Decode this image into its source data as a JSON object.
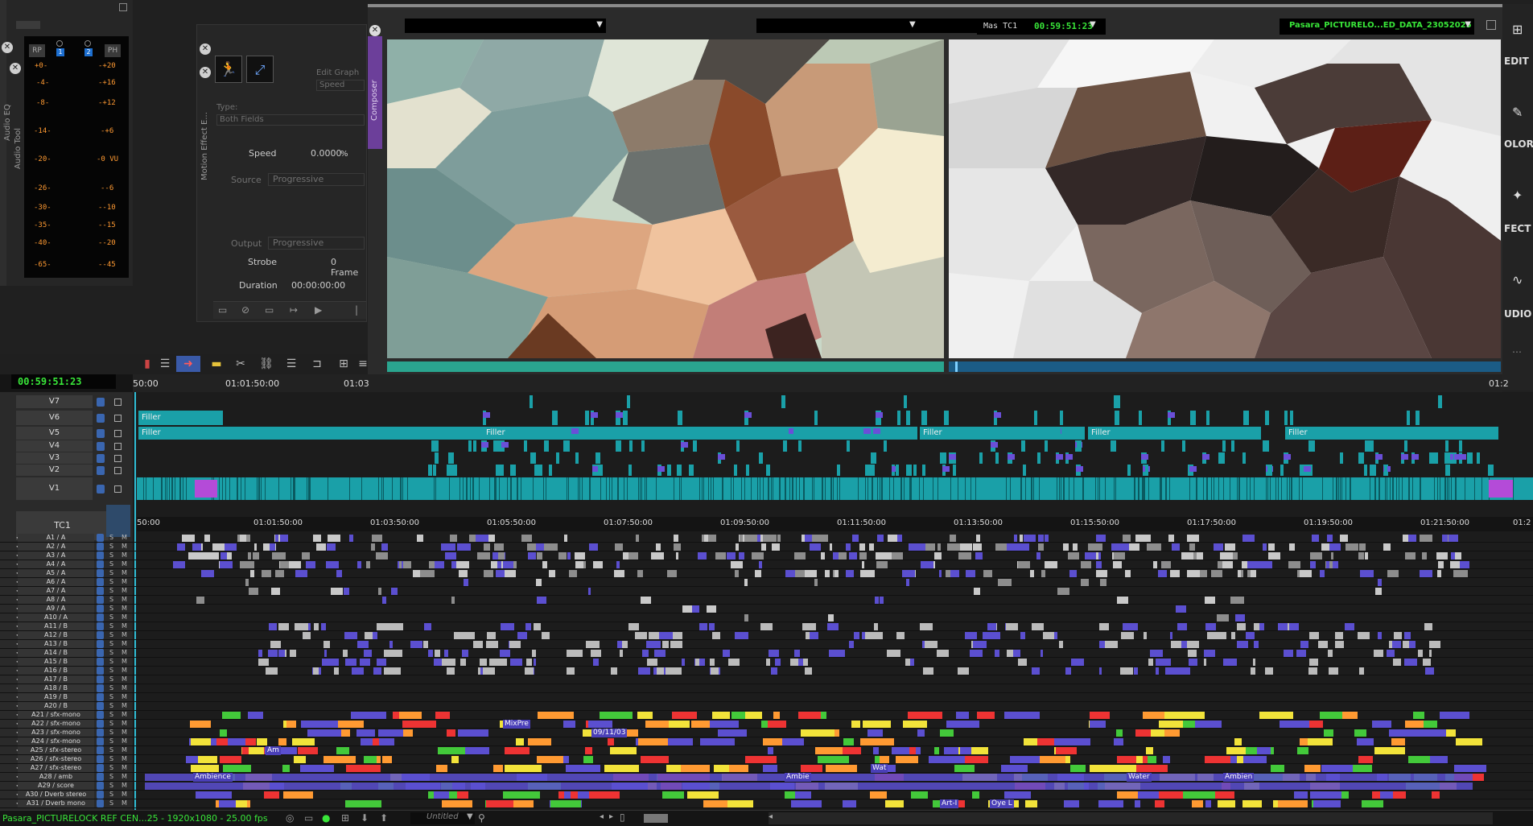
{
  "audio_tool": {
    "title": "Audio Tool",
    "header": [
      "RP",
      "PH"
    ],
    "channels": [
      "1",
      "2"
    ],
    "left_scale": [
      "+0-",
      "-4-",
      "-8-",
      "-14-",
      "-20-",
      "-26-",
      "-30-",
      "-35-",
      "-40-",
      "-65-"
    ],
    "right_scale": [
      "-+20",
      "-+16",
      "-+12",
      "-+6",
      "-0 VU",
      "--6",
      "--10",
      "--15",
      "--20",
      "--45"
    ]
  },
  "audio_eq": {
    "title": "Audio EQ"
  },
  "motion_effect": {
    "title": "Motion Effect E...",
    "edit_graph_label": "Edit Graph",
    "edit_graph_value": "Speed",
    "type_label": "Type:",
    "type_value": "Both Fields",
    "speed_label": "Speed",
    "speed_value": "0.0000",
    "speed_unit": "%",
    "source_label": "Source",
    "source_value": "Progressive",
    "output_label": "Output",
    "output_value": "Progressive",
    "strobe_label": "Strobe",
    "strobe_value": "0 Frame",
    "duration_label": "Duration",
    "duration_value": "00:00:00:00"
  },
  "composer": {
    "title": "Composer",
    "timecode_label": "Mas  TC1",
    "timecode": "00:59:51:23",
    "sequence_name": "Pasara_PICTURELO...ED_DATA_23052025"
  },
  "side_tabs": [
    "EDIT",
    "OLOR",
    "FECT",
    "UDIO"
  ],
  "timeline": {
    "master_timecode": "00:59:51:23",
    "top_ruler": [
      "50:00",
      "01:01:50:00",
      "01:03"
    ],
    "ruler": [
      "50:00",
      "01:01:50:00",
      "01:03:50:00",
      "01:05:50:00",
      "01:07:50:00",
      "01:09:50:00",
      "01:11:50:00",
      "01:13:50:00",
      "01:15:50:00",
      "01:17:50:00",
      "01:19:50:00",
      "01:21:50:00",
      "01:2"
    ],
    "video_tracks": [
      "V7",
      "V6",
      "V5",
      "V4",
      "V3",
      "V2",
      "V1"
    ],
    "tc_track": "TC1",
    "filler_label": "Filler",
    "audio_tracks": [
      "A1 / A",
      "A2 / A",
      "A3 / A",
      "A4 / A",
      "A5 / A",
      "A6 / A",
      "A7 / A",
      "A8 / A",
      "A9 / A",
      "A10 / A",
      "A11 / B",
      "A12 / B",
      "A13 / B",
      "A14 / B",
      "A15 / B",
      "A16 / B",
      "A17 / B",
      "A18 / B",
      "A19 / B",
      "A20 / B",
      "A21 / sfx-mono",
      "A22 / sfx-mono",
      "A23 / sfx-mono",
      "A24 / sfx-mono",
      "A25 / sfx-stereo",
      "A26 / sfx-stereo",
      "A27 / sfx-stereo",
      "A28 / amb",
      "A29 / score",
      "A30 / Dverb stereo",
      "A31 / Dverb mono"
    ],
    "clip_texts": [
      "MixPre",
      "Ambience",
      "Ambien",
      "Ambie",
      "Art-I",
      "Oye L",
      "Water",
      "Wat",
      "Am",
      "09/11/03"
    ]
  },
  "status_bar": {
    "project": "Pasara_PICTURELOCK REF CEN...25 - 1920x1080 - 25.00 fps",
    "bin": "Untitled"
  },
  "colors": {
    "teal": "#1aa0a8",
    "purple": "#6a4fd8",
    "green_tc": "#39e639",
    "orange": "#ff9a32"
  }
}
